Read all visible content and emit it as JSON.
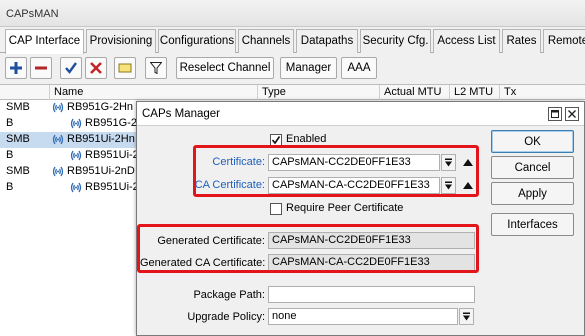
{
  "window": {
    "title": "CAPsMAN"
  },
  "tabs": [
    {
      "label": "CAP Interface",
      "active": true
    },
    {
      "label": "Provisioning"
    },
    {
      "label": "Configurations"
    },
    {
      "label": "Channels"
    },
    {
      "label": "Datapaths"
    },
    {
      "label": "Security Cfg."
    },
    {
      "label": "Access List"
    },
    {
      "label": "Rates"
    },
    {
      "label": "Remote"
    }
  ],
  "toolbar": {
    "icons": [
      "plus-icon",
      "minus-icon",
      "check-icon",
      "x-icon",
      "comment-icon",
      "filter-icon"
    ],
    "reselect_channel": "Reselect Channel",
    "manager": "Manager",
    "aaa": "AAA"
  },
  "table": {
    "columns": [
      "Name",
      "Type",
      "Actual MTU",
      "L2 MTU",
      "Tx"
    ],
    "rows": [
      {
        "flag": "SMB",
        "name": "RB951G-2Hn",
        "indent": false,
        "selected": false
      },
      {
        "flag": "B",
        "name": "RB951G-2",
        "indent": true,
        "selected": false
      },
      {
        "flag": "SMB",
        "name": "RB951Ui-2Hn",
        "indent": false,
        "selected": true
      },
      {
        "flag": "B",
        "name": "RB951Ui-2",
        "indent": true,
        "selected": false
      },
      {
        "flag": "SMB",
        "name": "RB951Ui-2nD",
        "indent": false,
        "selected": false
      },
      {
        "flag": "B",
        "name": "RB951Ui-2",
        "indent": true,
        "selected": false
      }
    ]
  },
  "dialog": {
    "title": "CAPs Manager",
    "enabled_label": "Enabled",
    "enabled_checked": true,
    "certificate_label": "Certificate:",
    "certificate_value": "CAPsMAN-CC2DE0FF1E33",
    "ca_certificate_label": "CA Certificate:",
    "ca_certificate_value": "CAPsMAN-CA-CC2DE0FF1E33",
    "require_peer_label": "Require Peer Certificate",
    "require_peer_checked": false,
    "generated_cert_label": "Generated Certificate:",
    "generated_cert_value": "CAPsMAN-CC2DE0FF1E33",
    "generated_ca_label": "Generated CA Certificate:",
    "generated_ca_value": "CAPsMAN-CA-CC2DE0FF1E33",
    "package_path_label": "Package Path:",
    "package_path_value": "",
    "upgrade_policy_label": "Upgrade Policy:",
    "upgrade_policy_value": "none",
    "buttons": {
      "ok": "OK",
      "cancel": "Cancel",
      "apply": "Apply",
      "interfaces": "Interfaces"
    }
  },
  "colors": {
    "highlight": "#e3151a",
    "selected_row": "#c7dbf0",
    "label_blue": "#1f5fbf"
  }
}
